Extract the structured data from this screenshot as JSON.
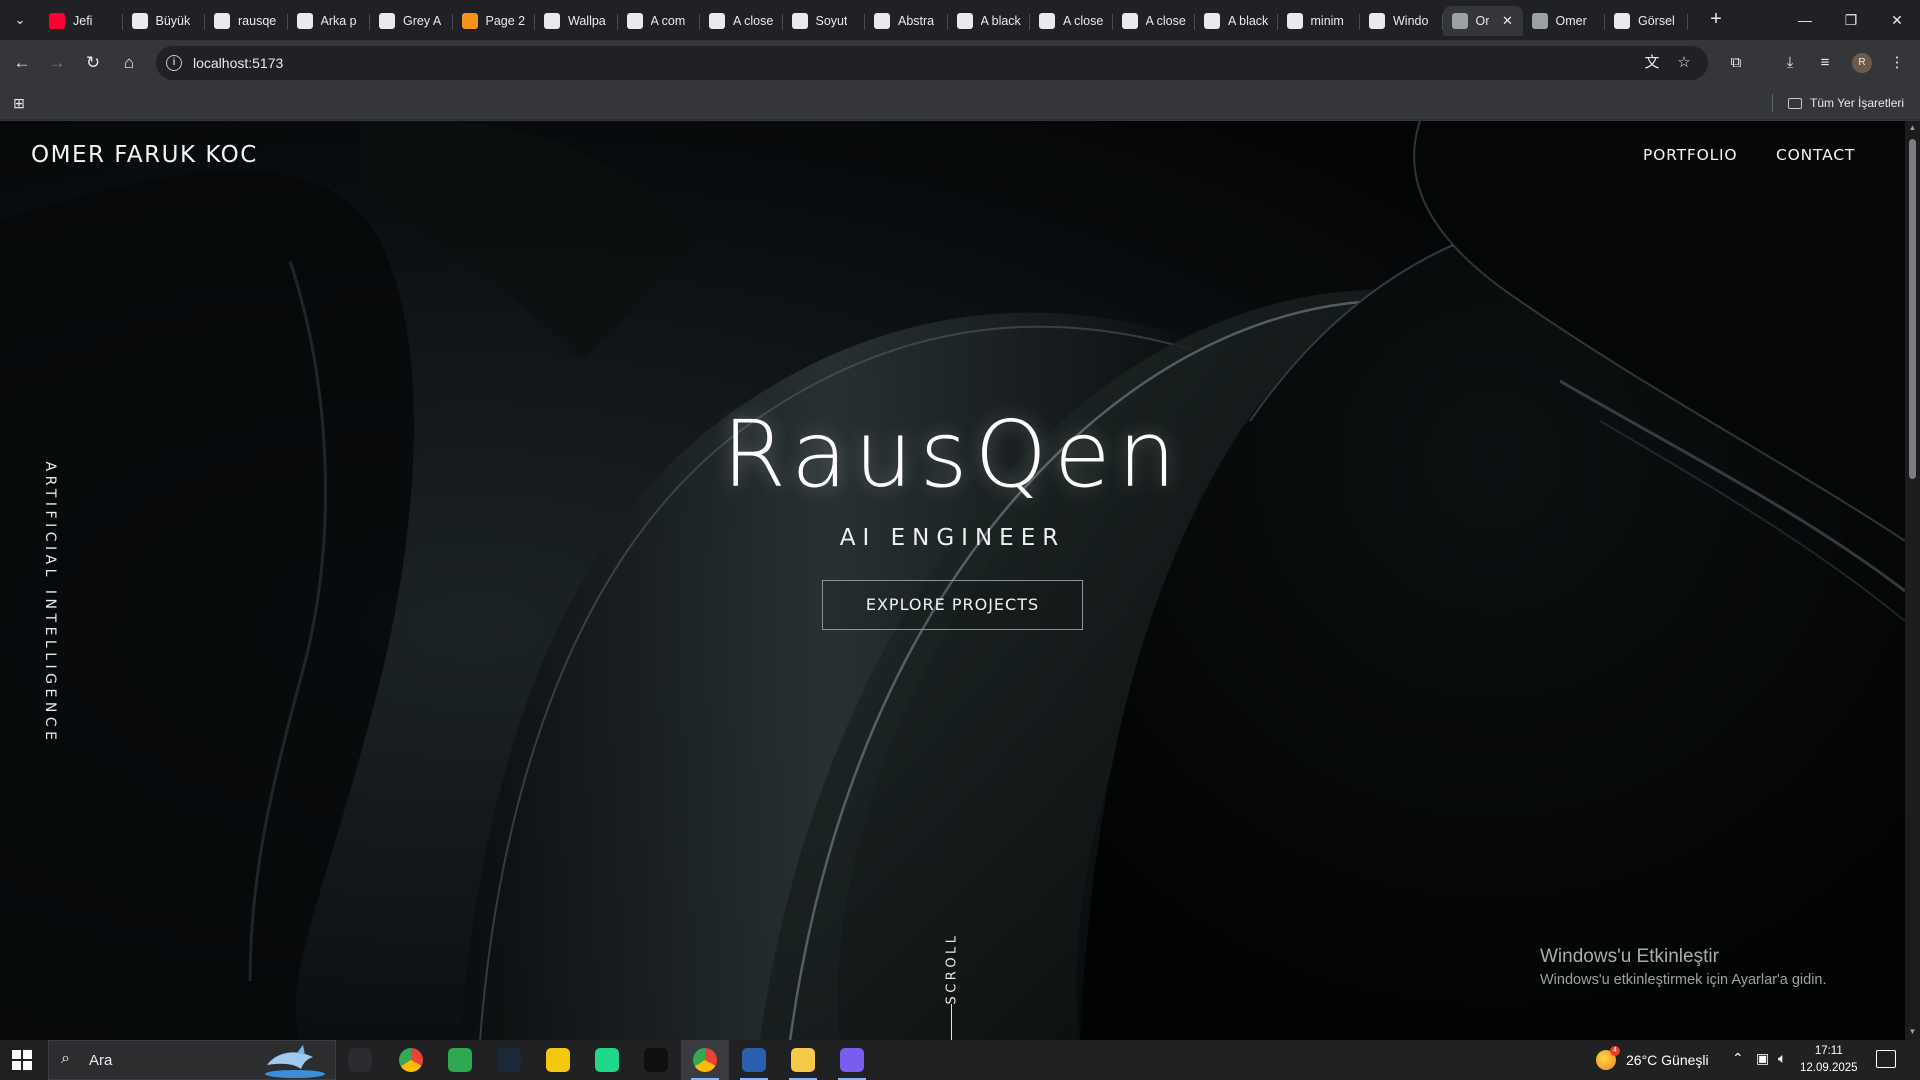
{
  "browser": {
    "tabs": [
      {
        "label": "Jefi",
        "icon": "youtube-icon",
        "color": "#ff0033"
      },
      {
        "label": "Büyük",
        "icon": "lightning-icon",
        "color": "#e8eaed"
      },
      {
        "label": "rausqe",
        "icon": "triangle-icon",
        "color": "#e8eaed"
      },
      {
        "label": "Arka p",
        "icon": "openai-icon",
        "color": "#e8eaed"
      },
      {
        "label": "Grey A",
        "icon": "unsplash-icon",
        "color": "#e8eaed"
      },
      {
        "label": "Page 2",
        "icon": "bitcoin-icon",
        "color": "#f7931a"
      },
      {
        "label": "Wallpa",
        "icon": "wallpaper-icon",
        "color": "#e8eaed"
      },
      {
        "label": "A com",
        "icon": "unsplash-icon",
        "color": "#e8eaed"
      },
      {
        "label": "A close",
        "icon": "unsplash-icon",
        "color": "#e8eaed"
      },
      {
        "label": "Soyut",
        "icon": "istock-icon",
        "color": "#e8eaed"
      },
      {
        "label": "Abstra",
        "icon": "istock-icon",
        "color": "#e8eaed"
      },
      {
        "label": "A black",
        "icon": "unsplash-icon",
        "color": "#e8eaed"
      },
      {
        "label": "A close",
        "icon": "unsplash-icon",
        "color": "#e8eaed"
      },
      {
        "label": "A close",
        "icon": "unsplash-icon",
        "color": "#e8eaed"
      },
      {
        "label": "A black",
        "icon": "unsplash-icon",
        "color": "#e8eaed"
      },
      {
        "label": "minim",
        "icon": "wallpaper-icon",
        "color": "#e8eaed"
      },
      {
        "label": "Windo",
        "icon": "wallpaper-icon",
        "color": "#e8eaed"
      },
      {
        "label": "Or",
        "icon": "globe-icon",
        "color": "#9aa0a6",
        "active": true
      },
      {
        "label": "Omer",
        "icon": "globe-icon",
        "color": "#9aa0a6"
      },
      {
        "label": "Görsel",
        "icon": "openai-icon",
        "color": "#e8eaed"
      }
    ],
    "url": "localhost:5173",
    "bookmarks_all": "Tüm Yer İşaretleri",
    "avatar_initial": "R"
  },
  "site": {
    "brand": "OMER FARUK KOC",
    "nav": [
      "PORTFOLIO",
      "CONTACT"
    ],
    "hero_title": "RausQen",
    "hero_subtitle": "AI ENGINEER",
    "cta": "EXPLORE PROJECTS",
    "side_label": "ARTIFICIAL INTELLIGENCE",
    "scroll_label": "SCROLL"
  },
  "activation": {
    "title": "Windows'u Etkinleştir",
    "subtitle": "Windows'u etkinleştirmek için Ayarlar'a gidin."
  },
  "taskbar": {
    "search_placeholder": "Ara",
    "weather": "26°C  Güneşli",
    "weather_badge": "4",
    "time": "17:11",
    "date": "12.09.2025",
    "apps": [
      {
        "name": "task-view-icon",
        "color": "#2b2c2f"
      },
      {
        "name": "chrome-icon",
        "color": "#e94235"
      },
      {
        "name": "refresh-app-icon",
        "color": "#2fa84f"
      },
      {
        "name": "steam-icon",
        "color": "#1b2838"
      },
      {
        "name": "powerbi-icon",
        "color": "#f2c811"
      },
      {
        "name": "pycharm-icon",
        "color": "#21d789"
      },
      {
        "name": "terminal-app-icon",
        "color": "#101010"
      },
      {
        "name": "chrome-profile-icon",
        "color": "#e94235"
      },
      {
        "name": "powershell-icon",
        "color": "#2a5fb0"
      },
      {
        "name": "file-explorer-icon",
        "color": "#f7c948"
      },
      {
        "name": "purple-app-icon",
        "color": "#7b5cf0"
      }
    ],
    "accent": "#8ab4f8"
  }
}
